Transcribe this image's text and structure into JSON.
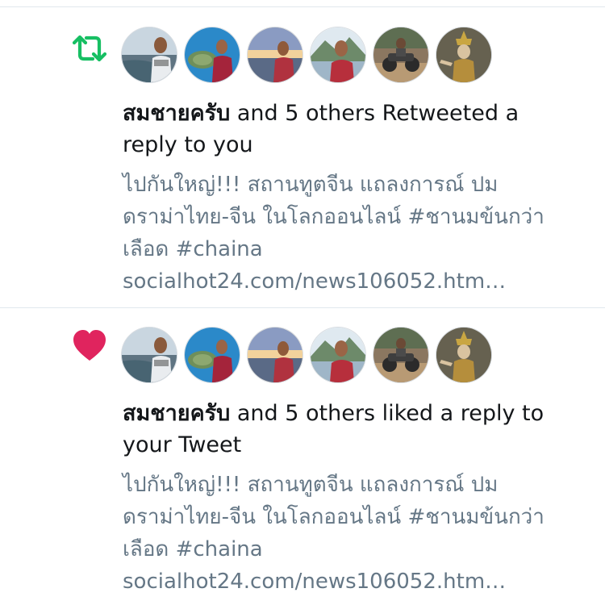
{
  "notifications": [
    {
      "type": "retweet",
      "icon": "retweet-icon",
      "icon_color": "#17bf63",
      "avatars": [
        "avatar-sea-man",
        "avatar-turtle-man",
        "avatar-sunset-man",
        "avatar-mountain-man",
        "avatar-atv-rider",
        "avatar-thai-dancer"
      ],
      "actor_name": "สมชายครับ",
      "action_text": " and 5 others Retweeted a reply to you",
      "tweet_lines": [
        "ไปกันใหญ่!!! สถานทูตจีน แถลงการณ์ ปม",
        "ดราม่าไทย-จีน ในโลกออนไลน์ #ชานมข้นกว่า",
        "เลือด #chaina"
      ],
      "link_text": "socialhot24.com/news106052.htm…"
    },
    {
      "type": "like",
      "icon": "heart-icon",
      "icon_color": "#e0245e",
      "avatars": [
        "avatar-sea-man",
        "avatar-turtle-man",
        "avatar-sunset-man",
        "avatar-mountain-man",
        "avatar-atv-rider",
        "avatar-thai-dancer"
      ],
      "actor_name": "สมชายครับ",
      "action_text": " and 5 others liked a reply to your Tweet",
      "tweet_lines": [
        "ไปกันใหญ่!!! สถานทูตจีน แถลงการณ์ ปม",
        "ดราม่าไทย-จีน ในโลกออนไลน์ #ชานมข้นกว่า",
        "เลือด #chaina"
      ],
      "link_text": "socialhot24.com/news106052.htm…"
    }
  ]
}
